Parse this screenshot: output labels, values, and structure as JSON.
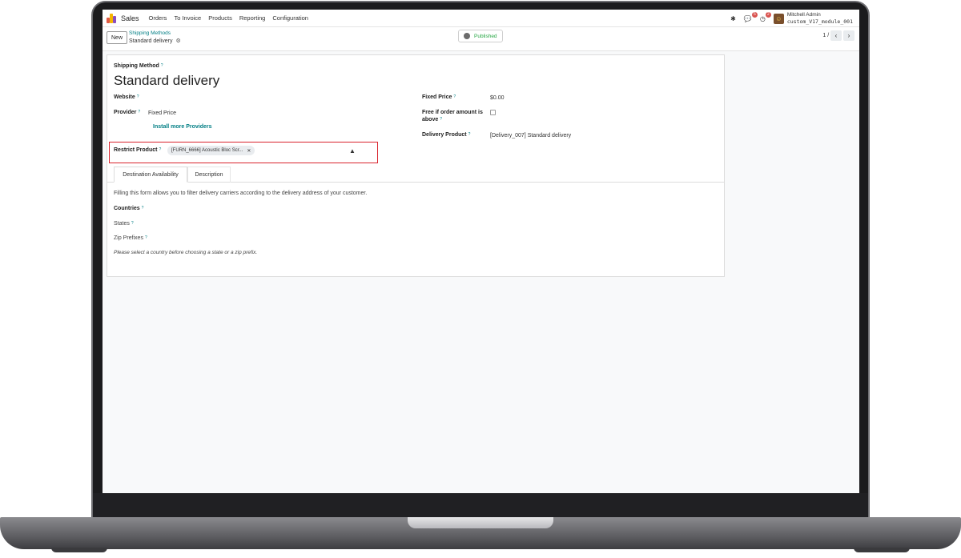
{
  "navbar": {
    "app_name": "Sales",
    "menu": [
      "Orders",
      "To Invoice",
      "Products",
      "Reporting",
      "Configuration"
    ],
    "messages_badge": "5",
    "activities_badge": "2",
    "user_name": "Mitchell Admin",
    "database": "custom_V17_module_001",
    "logo_colors": [
      "#e05a47",
      "#f5b400",
      "#8a4fbf"
    ]
  },
  "control": {
    "new_label": "New",
    "breadcrumb_parent": "Shipping Methods",
    "breadcrumb_current": "Standard delivery",
    "published_label": "Published",
    "pager": "1 / 3"
  },
  "form": {
    "shipping_method_label": "Shipping Method",
    "title": "Standard delivery",
    "website_label": "Website",
    "provider_label": "Provider",
    "provider_value": "Fixed Price",
    "install_link": "Install more Providers",
    "restrict_label": "Restrict Product",
    "restrict_tag": "[FURN_6666] Acoustic Bloc Scr...",
    "fixed_price_label": "Fixed Price",
    "fixed_price_value": "$0.00",
    "free_label_1": "Free if order amount is",
    "free_label_2": "above",
    "delivery_product_label": "Delivery Product",
    "delivery_product_value": "[Delivery_007] Standard delivery",
    "help_mark": "?"
  },
  "tabs": [
    "Destination Availability",
    "Description"
  ],
  "destination": {
    "description": "Filling this form allows you to filter delivery carriers according to the delivery address of your customer.",
    "countries_label": "Countries",
    "states_label": "States",
    "zip_label": "Zip Prefixes",
    "note": "Please select a country before choosing a state or a zip prefix."
  }
}
